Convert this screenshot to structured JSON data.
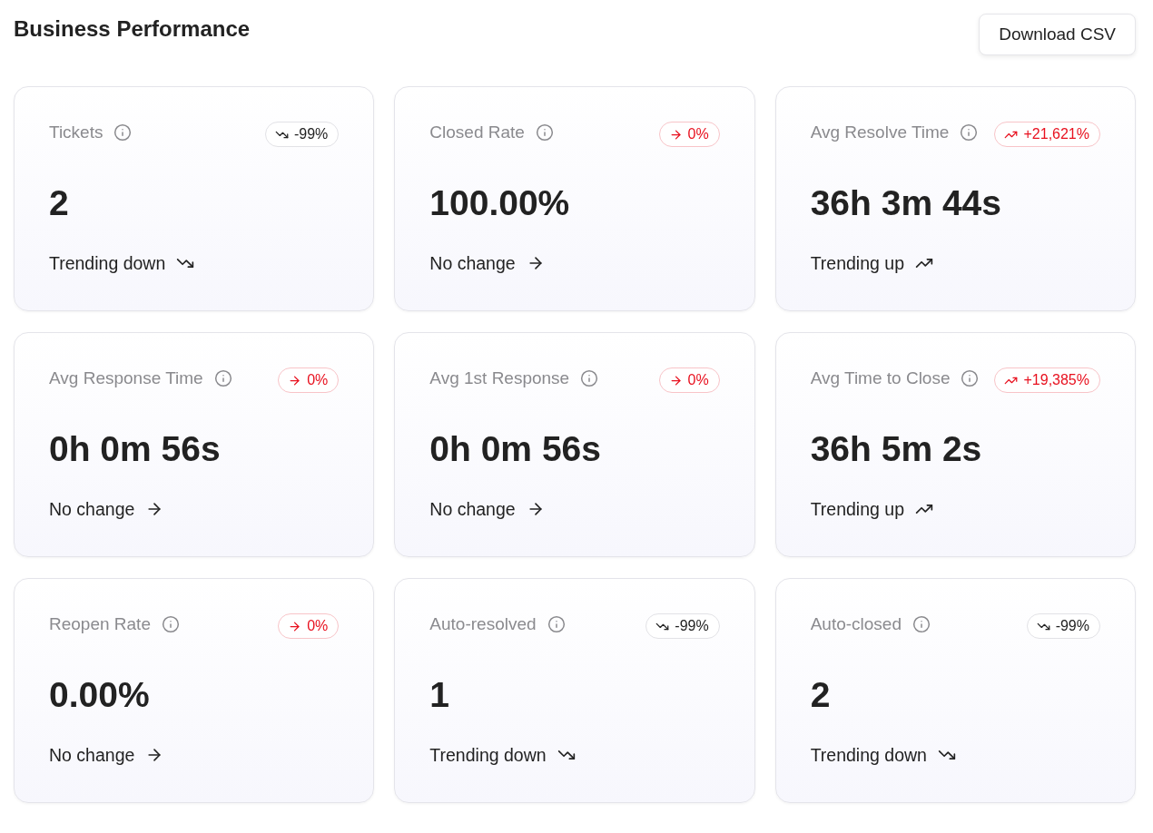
{
  "title": "Business Performance",
  "download_button": "Download CSV",
  "metrics": [
    {
      "label": "Tickets",
      "kind": "down",
      "change": "-99%",
      "negative": false,
      "value": "2",
      "summary": "Trending down"
    },
    {
      "label": "Closed Rate",
      "kind": "flat",
      "change": "0%",
      "negative": true,
      "value": "100.00%",
      "summary": "No change"
    },
    {
      "label": "Avg Resolve Time",
      "kind": "up",
      "change": "+21,621%",
      "negative": true,
      "value": "36h 3m 44s",
      "summary": "Trending up"
    },
    {
      "label": "Avg Response Time",
      "kind": "flat",
      "change": "0%",
      "negative": true,
      "value": "0h 0m 56s",
      "summary": "No change"
    },
    {
      "label": "Avg 1st Response",
      "kind": "flat",
      "change": "0%",
      "negative": true,
      "value": "0h 0m 56s",
      "summary": "No change"
    },
    {
      "label": "Avg Time to Close",
      "kind": "up",
      "change": "+19,385%",
      "negative": true,
      "value": "36h 5m 2s",
      "summary": "Trending up"
    },
    {
      "label": "Reopen Rate",
      "kind": "flat",
      "change": "0%",
      "negative": true,
      "value": "0.00%",
      "summary": "No change"
    },
    {
      "label": "Auto-resolved",
      "kind": "down",
      "change": "-99%",
      "negative": false,
      "value": "1",
      "summary": "Trending down"
    },
    {
      "label": "Auto-closed",
      "kind": "down",
      "change": "-99%",
      "negative": false,
      "value": "2",
      "summary": "Trending down"
    }
  ]
}
